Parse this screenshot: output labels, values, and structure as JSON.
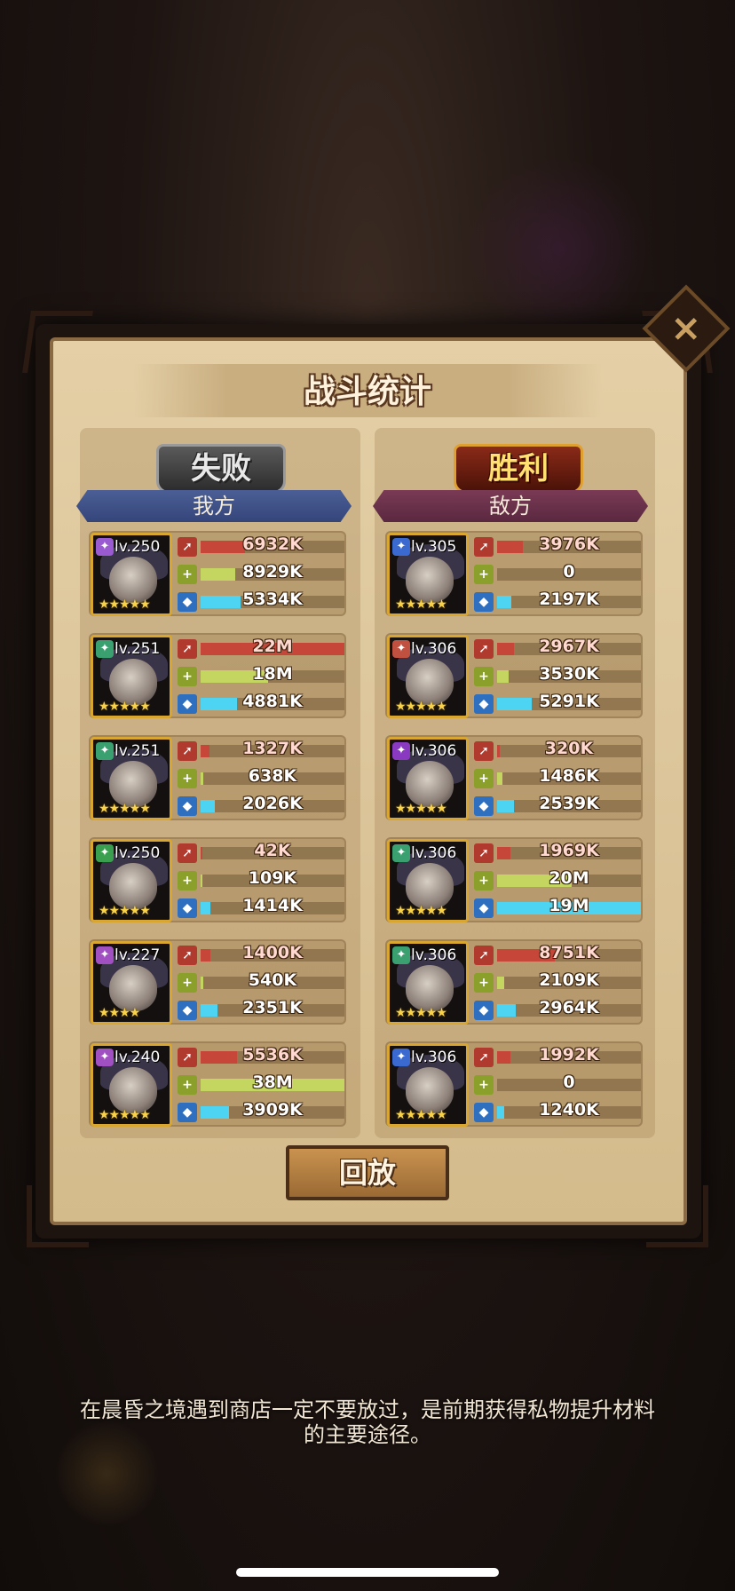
{
  "title": "战斗统计",
  "close_label": "×",
  "left": {
    "result": "失败",
    "side": "我方",
    "heroes": [
      {
        "level": "lv.250",
        "class_icon": "mage-icon",
        "class_color": "#9a5ad0",
        "stars": "★★★★★",
        "stars_count": 5,
        "atk": "6932K",
        "heal": "8929K",
        "def": "5334K",
        "atk_pct": 0.31,
        "heal_pct": 0.24,
        "def_pct": 0.28
      },
      {
        "level": "lv.251",
        "class_icon": "support-icon",
        "class_color": "#3aa070",
        "stars": "★★★★★",
        "stars_count": 5,
        "atk": "22M",
        "heal": "18M",
        "def": "4881K",
        "atk_pct": 1.0,
        "heal_pct": 0.47,
        "def_pct": 0.25
      },
      {
        "level": "lv.251",
        "class_icon": "support-icon",
        "class_color": "#3aa070",
        "stars": "★★★★★",
        "stars_count": 5,
        "atk": "1327K",
        "heal": "638K",
        "def": "2026K",
        "atk_pct": 0.06,
        "heal_pct": 0.02,
        "def_pct": 0.1
      },
      {
        "level": "lv.250",
        "class_icon": "healer-icon",
        "class_color": "#3aa050",
        "stars": "★★★★★",
        "stars_count": 5,
        "atk": "42K",
        "heal": "109K",
        "def": "1414K",
        "atk_pct": 0.01,
        "heal_pct": 0.01,
        "def_pct": 0.07
      },
      {
        "level": "lv.227",
        "class_icon": "healer-icon",
        "class_color": "#a050c0",
        "stars": "★★★★",
        "stars_count": 4,
        "atk": "1400K",
        "heal": "540K",
        "def": "2351K",
        "atk_pct": 0.07,
        "heal_pct": 0.02,
        "def_pct": 0.12
      },
      {
        "level": "lv.240",
        "class_icon": "healer-icon",
        "class_color": "#a050c0",
        "stars": "★★★★★",
        "stars_count": 5,
        "atk": "5536K",
        "heal": "38M",
        "def": "3909K",
        "atk_pct": 0.25,
        "heal_pct": 1.0,
        "def_pct": 0.2
      }
    ]
  },
  "right": {
    "result": "胜利",
    "side": "敌方",
    "heroes": [
      {
        "level": "lv.305",
        "class_icon": "archer-icon",
        "class_color": "#3a6ad0",
        "stars": "★★★★★",
        "stars_count": 5,
        "atk": "3976K",
        "heal": "0",
        "def": "2197K",
        "atk_pct": 0.18,
        "heal_pct": 0.0,
        "def_pct": 0.1
      },
      {
        "level": "lv.306",
        "class_icon": "warrior-icon",
        "class_color": "#c05040",
        "stars": "★★★★★",
        "stars_count": 5,
        "atk": "2967K",
        "heal": "3530K",
        "def": "5291K",
        "atk_pct": 0.12,
        "heal_pct": 0.08,
        "def_pct": 0.24
      },
      {
        "level": "lv.306",
        "class_icon": "assassin-icon",
        "class_color": "#8a3ac0",
        "stars": "★★★★★",
        "stars_count": 5,
        "atk": "320K",
        "heal": "1486K",
        "def": "2539K",
        "atk_pct": 0.02,
        "heal_pct": 0.04,
        "def_pct": 0.12
      },
      {
        "level": "lv.306",
        "class_icon": "mage-icon",
        "class_color": "#3aa070",
        "stars": "★★★★★",
        "stars_count": 5,
        "atk": "1969K",
        "heal": "20M",
        "def": "19M",
        "atk_pct": 0.09,
        "heal_pct": 0.52,
        "def_pct": 1.0
      },
      {
        "level": "lv.306",
        "class_icon": "support-icon",
        "class_color": "#3aa070",
        "stars": "★★★★★",
        "stars_count": 5,
        "atk": "8751K",
        "heal": "2109K",
        "def": "2964K",
        "atk_pct": 0.4,
        "heal_pct": 0.05,
        "def_pct": 0.13
      },
      {
        "level": "lv.306",
        "class_icon": "archer-icon",
        "class_color": "#3a6ad0",
        "stars": "★★★★★",
        "stars_count": 5,
        "atk": "1992K",
        "heal": "0",
        "def": "1240K",
        "atk_pct": 0.09,
        "heal_pct": 0.0,
        "def_pct": 0.05
      }
    ]
  },
  "stat_icons": {
    "atk": "sword-icon",
    "heal": "plus-icon",
    "def": "shield-icon"
  },
  "replay_label": "回放",
  "tip_line1": "在晨昏之境遇到商店一定不要放过，是前期获得私物提升材料",
  "tip_line2": "的主要途径。"
}
